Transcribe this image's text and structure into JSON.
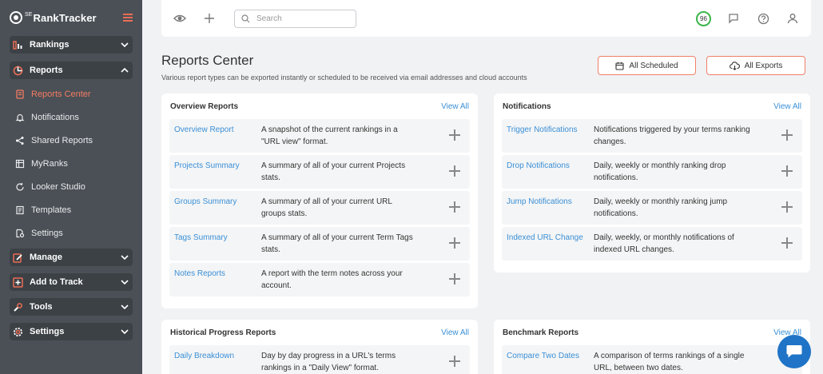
{
  "brand": {
    "name": "RankTracker",
    "prefix": "SE"
  },
  "sidebar": {
    "groups": [
      {
        "label": "Rankings",
        "icon": "bar-chart-icon",
        "expanded": false
      },
      {
        "label": "Reports",
        "icon": "pie-chart-icon",
        "expanded": true
      },
      {
        "label": "Manage",
        "icon": "edit-icon",
        "expanded": false
      },
      {
        "label": "Add to Track",
        "icon": "plus-square-icon",
        "expanded": false
      },
      {
        "label": "Tools",
        "icon": "tools-icon",
        "expanded": false
      },
      {
        "label": "Settings",
        "icon": "gear-icon",
        "expanded": false
      }
    ],
    "reports_items": [
      {
        "label": "Reports Center",
        "icon": "document-icon",
        "active": true
      },
      {
        "label": "Notifications",
        "icon": "bell-icon",
        "active": false
      },
      {
        "label": "Shared Reports",
        "icon": "share-icon",
        "active": false
      },
      {
        "label": "MyRanks",
        "icon": "table-icon",
        "active": false
      },
      {
        "label": "Looker Studio",
        "icon": "refresh-icon",
        "active": false
      },
      {
        "label": "Templates",
        "icon": "template-icon",
        "active": false
      },
      {
        "label": "Settings",
        "icon": "file-gear-icon",
        "active": false
      }
    ]
  },
  "topbar": {
    "search_placeholder": "Search",
    "score": "96"
  },
  "header": {
    "title": "Reports Center",
    "subtitle": "Various report types can be exported instantly or scheduled to be received via email addresses and cloud accounts",
    "scheduled_label": "All Scheduled",
    "exports_label": "All Exports"
  },
  "cards": {
    "overview": {
      "title": "Overview Reports",
      "view_all": "View All",
      "rows": [
        {
          "name": "Overview Report",
          "desc": "A snapshot of the current rankings in a \"URL view\" format."
        },
        {
          "name": "Projects Summary",
          "desc": "A summary of all of your current Projects stats."
        },
        {
          "name": "Groups Summary",
          "desc": "A summary of all of your current URL groups stats."
        },
        {
          "name": "Tags Summary",
          "desc": "A summary of all of your current Term Tags stats."
        },
        {
          "name": "Notes Reports",
          "desc": "A report with the term notes across your account."
        }
      ]
    },
    "notifications": {
      "title": "Notifications",
      "view_all": "View All",
      "rows": [
        {
          "name": "Trigger Notifications",
          "desc": "Notifications triggered by your terms ranking changes."
        },
        {
          "name": "Drop Notifications",
          "desc": "Daily, weekly or monthly ranking drop notifications."
        },
        {
          "name": "Jump Notifications",
          "desc": "Daily, weekly or monthly ranking jump notifications."
        },
        {
          "name": "Indexed URL Change",
          "desc": "Daily, weekly, or monthly notifications of indexed URL changes."
        }
      ]
    },
    "historical": {
      "title": "Historical Progress Reports",
      "view_all": "View All",
      "rows": [
        {
          "name": "Daily Breakdown",
          "desc": "Day by day progress in a URL's terms rankings in a \"Daily View\" format."
        }
      ]
    },
    "benchmark": {
      "title": "Benchmark Reports",
      "view_all": "View All",
      "rows": [
        {
          "name": "Compare Two Dates",
          "desc": "A comparison of terms rankings of a single URL, between two dates."
        }
      ]
    }
  },
  "colors": {
    "sidebar_bg": "#4a5056",
    "accent": "#f08068",
    "link": "#3a8fd6",
    "score_ring": "#3bb54a",
    "chat": "#1f74c7"
  }
}
